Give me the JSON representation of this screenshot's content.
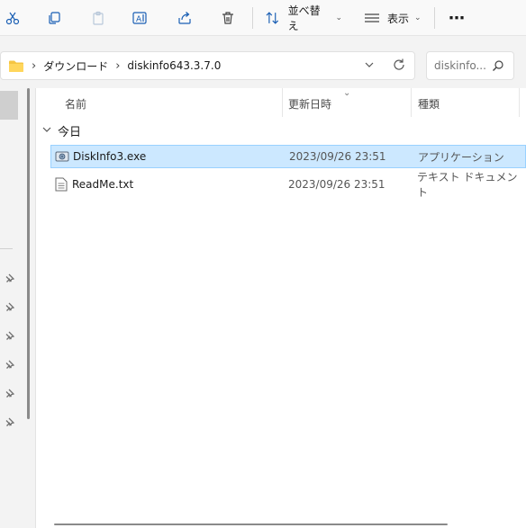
{
  "toolbar": {
    "sort_label": "並べ替え",
    "view_label": "表示",
    "more_label": "⋯"
  },
  "address": {
    "crumbs": [
      "ダウンロード",
      "diskinfo643.3.7.0"
    ]
  },
  "search": {
    "placeholder": "diskinfo..."
  },
  "columns": {
    "name": "名前",
    "modified": "更新日時",
    "type": "種類"
  },
  "group": {
    "label": "今日"
  },
  "files": [
    {
      "name": "DiskInfo3.exe",
      "modified": "2023/09/26 23:51",
      "type": "アプリケーション",
      "icon": "app-icon",
      "selected": true
    },
    {
      "name": "ReadMe.txt",
      "modified": "2023/09/26 23:51",
      "type": "テキスト ドキュメント",
      "icon": "text-file-icon",
      "selected": false
    }
  ],
  "colors": {
    "accent": "#1a5fb4",
    "selection_bg": "#cce8ff",
    "selection_border": "#99d1ff"
  }
}
